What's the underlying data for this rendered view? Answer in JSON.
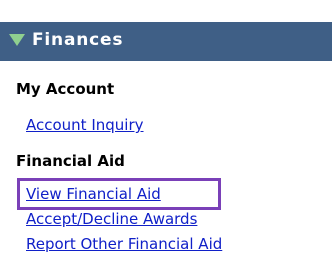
{
  "header": {
    "title": "Finances",
    "triangle_color": "#8fd08f",
    "background_color": "#3f5f86"
  },
  "sections": {
    "my_account": {
      "heading": "My Account",
      "links": [
        "Account Inquiry"
      ]
    },
    "financial_aid": {
      "heading": "Financial Aid",
      "links": [
        "View Financial Aid",
        "Accept/Decline Awards",
        "Report Other Financial Aid"
      ]
    }
  },
  "colors": {
    "link": "#1020c8",
    "highlight": "#7a40b8"
  }
}
